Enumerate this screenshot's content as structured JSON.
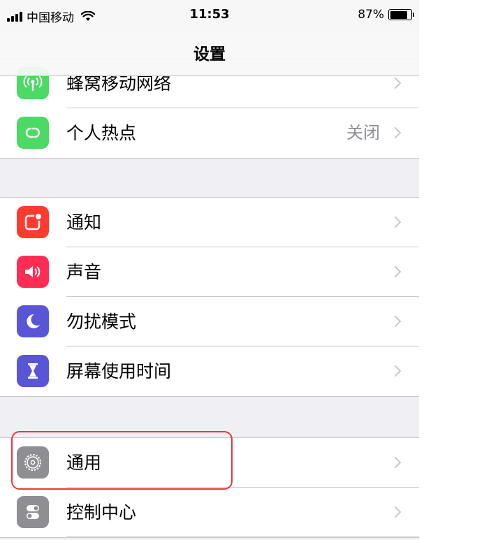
{
  "status_bar": {
    "carrier": "中国移动",
    "time": "11:53",
    "battery": "87%"
  },
  "nav": {
    "title": "设置"
  },
  "groups": [
    {
      "items": [
        {
          "label": "蜂窝移动网络",
          "icon": "cellular-antenna-icon",
          "color": "#4cd964"
        },
        {
          "label": "个人热点",
          "value": "关闭",
          "icon": "hotspot-link-icon",
          "color": "#4cd964"
        }
      ]
    },
    {
      "items": [
        {
          "label": "通知",
          "icon": "notifications-icon",
          "color": "#ff3b30"
        },
        {
          "label": "声音",
          "icon": "speaker-icon",
          "color": "#ff2d55"
        },
        {
          "label": "勿扰模式",
          "icon": "moon-icon",
          "color": "#5856d6"
        },
        {
          "label": "屏幕使用时间",
          "icon": "hourglass-icon",
          "color": "#5856d6"
        }
      ]
    },
    {
      "items": [
        {
          "label": "通用",
          "icon": "gear-icon",
          "color": "#8e8e93"
        },
        {
          "label": "控制中心",
          "icon": "toggles-icon",
          "color": "#8e8e93"
        }
      ]
    }
  ],
  "highlight": {
    "target": "通用",
    "color": "#e8373b"
  }
}
